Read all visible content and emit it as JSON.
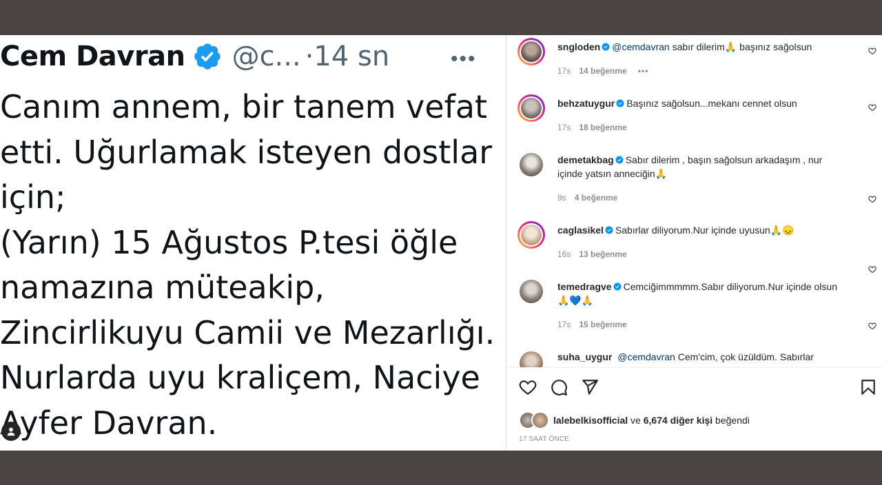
{
  "tweet": {
    "author_name": "Cem Davran",
    "author_handle": "@c...",
    "time": "·14 sn",
    "more_icon": "ellipsis-icon",
    "lines": [
      "Canım annem, bir tanem vefat",
      "etti. Uğurlamak isteyen dostlar",
      "için;",
      "(Yarın) 15 Ağustos P.tesi öğle",
      "namazına müteakip,",
      "Zincirlikuyu Camii ve Mezarlığı.",
      "Nurlarda uyu kraliçem, Naciye",
      "Ayfer Davran."
    ]
  },
  "comments": [
    {
      "user": "sngloden",
      "mention": "@cemdavran",
      "text": " sabır dilerim🙏 başınız sağolsun",
      "time": "17s",
      "likes": "14 beğenme",
      "more": "•••"
    },
    {
      "user": "behzatuygur",
      "mention": "",
      "text": "Başınız sağolsun...mekanı cennet olsun",
      "time": "17s",
      "likes": "18 beğenme"
    },
    {
      "user": "demetakbag",
      "mention": "",
      "text": "Sabır dilerim , başın sağolsun arkadaşım , nur içinde yatsın anneciğin🙏",
      "time": "9s",
      "likes": "4 beğenme"
    },
    {
      "user": "caglasikel",
      "mention": "",
      "text": "Sabırlar diliyorum.Nur içinde uyusun🙏😞",
      "time": "16s",
      "likes": "13 beğenme"
    },
    {
      "user": "temedragve",
      "mention": "",
      "text": "Cemciğimmmmm.Sabır diliyorum.Nur içinde olsun🙏💙🙏",
      "time": "17s",
      "likes": "15 beğenme"
    },
    {
      "user": "suha_uygur",
      "mention": "@cemdavran",
      "text": " Cem'cim, çok üzüldüm. Sabırlar",
      "time": "",
      "likes": ""
    }
  ],
  "likes_summary": {
    "user": "lalebelkisofficial",
    "connector": " ve ",
    "others": "6,674 diğer kişi",
    "suffix": " beğendi"
  },
  "post_time": "17 SAAT ÖNCE",
  "icons": {
    "verified": "verified-badge-icon",
    "like": "heart-icon",
    "comment": "comment-bubble-icon",
    "share": "paper-plane-icon",
    "save": "bookmark-icon",
    "user_tag": "user-tag-icon"
  },
  "colors": {
    "twitter_verified": "#1d9bf0",
    "instagram_verified": "#0095f6",
    "mention": "#00376b",
    "frame": "#4a4443"
  }
}
